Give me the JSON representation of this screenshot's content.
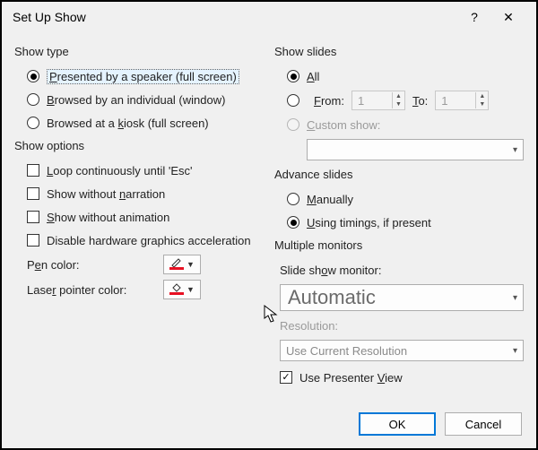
{
  "dialog": {
    "title": "Set Up Show",
    "help": "?",
    "close": "✕"
  },
  "show_type": {
    "title": "Show type",
    "opt1_pre": "",
    "opt1_u": "P",
    "opt1_post": "resented by a speaker (full screen)",
    "opt2_pre": "",
    "opt2_u": "B",
    "opt2_post": "rowsed by an individual (window)",
    "opt3_pre": "Browsed at a ",
    "opt3_u": "k",
    "opt3_post": "iosk (full screen)"
  },
  "show_options": {
    "title": "Show options",
    "loop_pre": "",
    "loop_u": "L",
    "loop_post": "oop continuously until 'Esc'",
    "narr_pre": "Show without ",
    "narr_u": "n",
    "narr_post": "arration",
    "anim_pre": "",
    "anim_u": "S",
    "anim_post": "how without animation",
    "hw": "Disable hardware graphics acceleration",
    "pen_pre": "P",
    "pen_u": "e",
    "pen_post": "n color:",
    "laser_pre": "Lase",
    "laser_u": "r",
    "laser_post": " pointer color:"
  },
  "show_slides": {
    "title": "Show slides",
    "all_u": "A",
    "all_post": "ll",
    "from_u": "F",
    "from_post": "rom:",
    "to_pre": "",
    "to_u": "T",
    "to_post": "o:",
    "from_val": "1",
    "to_val": "1",
    "custom_pre": "",
    "custom_u": "C",
    "custom_post": "ustom show:",
    "custom_value": ""
  },
  "advance": {
    "title": "Advance slides",
    "manual_u": "M",
    "manual_post": "anually",
    "timing_pre": "",
    "timing_u": "U",
    "timing_post": "sing timings, if present"
  },
  "monitors": {
    "title": "Multiple monitors",
    "mon_pre": "Slide sh",
    "mon_u": "o",
    "mon_post": "w monitor:",
    "mon_value": "Automatic",
    "res_label": "Resolution:",
    "res_value": "Use Current Resolution",
    "presenter_pre": "Use Presenter ",
    "presenter_u": "V",
    "presenter_post": "iew"
  },
  "buttons": {
    "ok": "OK",
    "cancel": "Cancel"
  }
}
